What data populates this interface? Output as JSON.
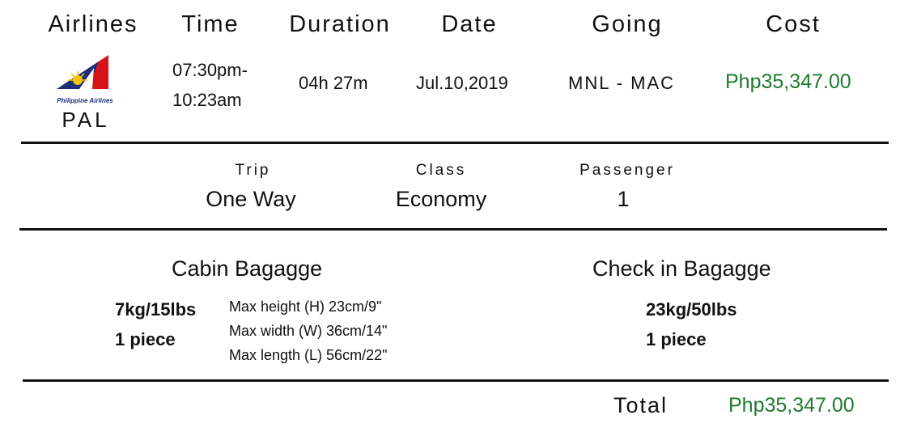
{
  "headers": {
    "airlines": "Airlines",
    "time": "Time",
    "duration": "Duration",
    "date": "Date",
    "going": "Going",
    "cost": "Cost"
  },
  "flight": {
    "logo_text": "Philippine Airlines",
    "airline_code": "PAL",
    "time_line1": "07:30pm-",
    "time_line2": "10:23am",
    "duration": "04h 27m",
    "date": "Jul.10,2019",
    "route": "MNL - MAC",
    "cost": "Php35,347.00"
  },
  "trip_info": {
    "trip_label": "Trip",
    "trip_value": "One Way",
    "class_label": "Class",
    "class_value": "Economy",
    "passenger_label": "Passenger",
    "passenger_value": "1"
  },
  "cabin_baggage": {
    "title": "Cabin Bagagge",
    "weight": "7kg/15lbs",
    "pieces": "1 piece",
    "max_height": "Max height (H) 23cm/9\"",
    "max_width": "Max width (W) 36cm/14\"",
    "max_length": "Max length (L) 56cm/22\""
  },
  "checkin_baggage": {
    "title": "Check in Bagagge",
    "weight": "23kg/50lbs",
    "pieces": "1 piece"
  },
  "total": {
    "label": "Total",
    "value": "Php35,347.00"
  },
  "colors": {
    "price_green": "#1e7a2e",
    "logo_red": "#d7141a",
    "logo_yellow": "#f2c500",
    "logo_blue": "#1d2f7a"
  }
}
